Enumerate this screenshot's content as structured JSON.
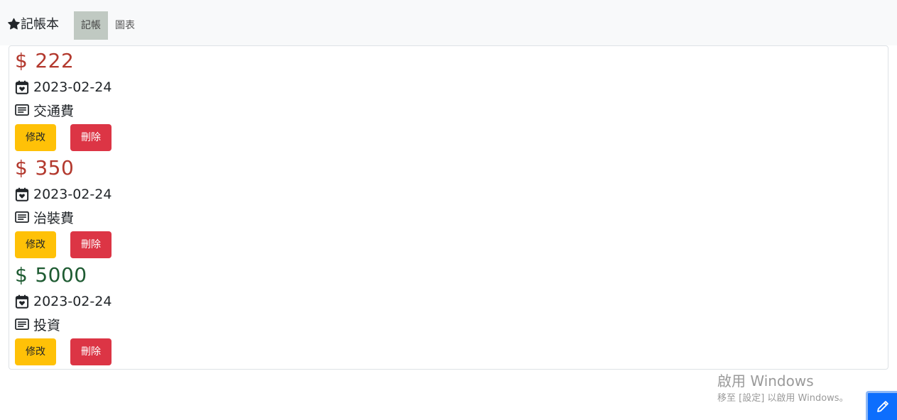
{
  "navbar": {
    "brand": "記帳本",
    "tabs": [
      {
        "label": "記帳",
        "active": true
      },
      {
        "label": "圖表",
        "active": false
      }
    ]
  },
  "entries": [
    {
      "currency": "$",
      "amount": "222",
      "type": "expense",
      "date": "2023-02-24",
      "note": "交通費",
      "edit_label": "修改",
      "delete_label": "刪除"
    },
    {
      "currency": "$",
      "amount": "350",
      "type": "expense",
      "date": "2023-02-24",
      "note": "治裝費",
      "edit_label": "修改",
      "delete_label": "刪除"
    },
    {
      "currency": "$",
      "amount": "5000",
      "type": "income",
      "date": "2023-02-24",
      "note": "投資",
      "edit_label": "修改",
      "delete_label": "刪除"
    }
  ],
  "watermark": {
    "line1": "啟用 Windows",
    "line2": "移至 [設定] 以啟用 Windows。"
  },
  "colors": {
    "expense": "#b3392e",
    "income": "#1e5b32",
    "edit_button": "#ffc107",
    "delete_button": "#dc3545",
    "fab": "#0d6efd"
  },
  "icons": {
    "brand": "star-icon",
    "date": "calendar-heart-icon",
    "note": "card-text-icon",
    "fab": "pencil-icon"
  }
}
